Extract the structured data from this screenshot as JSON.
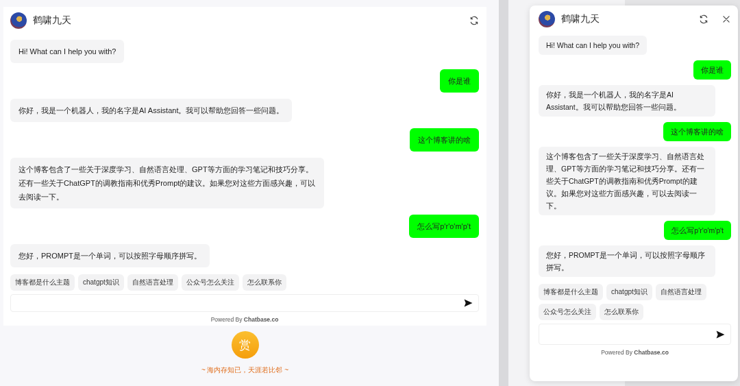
{
  "widgets": [
    {
      "title": "鹤啸九天",
      "closable": false,
      "messages": [
        {
          "kind": "bot",
          "text": "Hi! What can I help you with?"
        },
        {
          "kind": "user",
          "text": "你是谁"
        },
        {
          "kind": "bot",
          "text": "你好，我是一个机器人，我的名字是AI Assistant。我可以帮助您回答一些问题。"
        },
        {
          "kind": "user",
          "text": "这个博客讲的啥"
        },
        {
          "kind": "bot",
          "text": "这个博客包含了一些关于深度学习、自然语言处理、GPT等方面的学习笔记和技巧分享。还有一些关于ChatGPT的调教指南和优秀Prompt的建议。如果您对这些方面感兴趣，可以去阅读一下。"
        },
        {
          "kind": "user",
          "text": "怎么写p'r'o'm'p't"
        },
        {
          "kind": "bot",
          "text": "您好，PROMPT是一个单词，可以按照字母顺序拼写。"
        }
      ],
      "suggestions": [
        "博客都是什么主题",
        "chatgpt知识",
        "自然语言处理",
        "公众号怎么关注",
        "怎么联系你"
      ],
      "footer": "Powered By **Chatbase.co**"
    },
    {
      "title": "鹤啸九天",
      "closable": true,
      "messages": [
        {
          "kind": "bot",
          "text": "Hi! What can I help you with?"
        },
        {
          "kind": "user",
          "text": "你是谁"
        },
        {
          "kind": "bot",
          "text": "你好，我是一个机器人，我的名字是AI Assistant。我可以帮助您回答一些问题。"
        },
        {
          "kind": "user",
          "text": "这个博客讲的啥"
        },
        {
          "kind": "bot",
          "text": "这个博客包含了一些关于深度学习、自然语言处理、GPT等方面的学习笔记和技巧分享。还有一些关于ChatGPT的调教指南和优秀Prompt的建议。如果您对这些方面感兴趣，可以去阅读一下。"
        },
        {
          "kind": "user",
          "text": "怎么写p'r'o'm'p't"
        },
        {
          "kind": "bot",
          "text": "您好，PROMPT是一个单词，可以按照字母顺序拼写。"
        }
      ],
      "suggestions": [
        "博客都是什么主题",
        "chatgpt知识",
        "自然语言处理",
        "公众号怎么关注",
        "怎么联系你"
      ],
      "footer": "Powered By **Chatbase.co**"
    }
  ],
  "reward": {
    "button": "赏",
    "motto": "~ 海内存知已，天涯若比邻 ~"
  }
}
